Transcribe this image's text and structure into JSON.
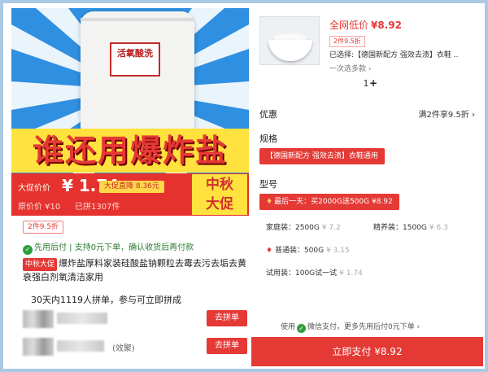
{
  "left": {
    "headline": "谁还用爆炸盐",
    "bag_label": "活氧酸洗",
    "price_label": "大促价价",
    "price": "¥ 1.74",
    "promo_tag": "大促直降 8.36元",
    "orig_price": "原价价 ¥10",
    "sold": "已拼1307件",
    "festival": "中秋\n大促",
    "discount_tag": "2件9.5折",
    "assurance": "先用后付 | 支持0元下单，确认收货后再付款",
    "title_badge": "中秋大促",
    "product_title": "爆炸盐厚料家装硅酸盐钠颗粒去霉去污去垢去黄衰强白剂氧清洁家用",
    "group_note": "30天内1119人拼单，参与可立即拼成",
    "group_rows": [
      {
        "suffix": "",
        "join": "去拼单"
      },
      {
        "suffix": "(效聚)",
        "join": "去拼单"
      }
    ]
  },
  "right": {
    "net_low_label": "全网低价",
    "net_low_price": "¥8.92",
    "small_discount": "2件9.5折",
    "selected": "已选择:【德国新配方 强效去渍】衣鞋 ..",
    "choose": "一次选多款 ›",
    "qty": "1",
    "plus": "+",
    "offer_title": "优惠",
    "offer_value": "满2件享9.5折 ›",
    "spec_title": "规格",
    "spec_option": "【德国新配方 强效去渍】衣鞋通用",
    "model_title": "型号",
    "model_option": "最后一天：买2000G送500G ¥8.92",
    "options": [
      {
        "name": "家庭装：2500G",
        "price": "¥ 7.2"
      },
      {
        "name": "精养装：1500G",
        "price": "¥ 6.3"
      },
      {
        "name": "普通装：500G",
        "price": "¥ 3.15"
      },
      {
        "name": "试用装：100G试一试",
        "price": "¥ 1.74"
      }
    ],
    "pay_note_pre": "使用",
    "pay_note_wx": "微信支付",
    "pay_note_post": "，更多先用后付0元下单 ›",
    "pay_button": "立即支付 ¥8.92"
  }
}
